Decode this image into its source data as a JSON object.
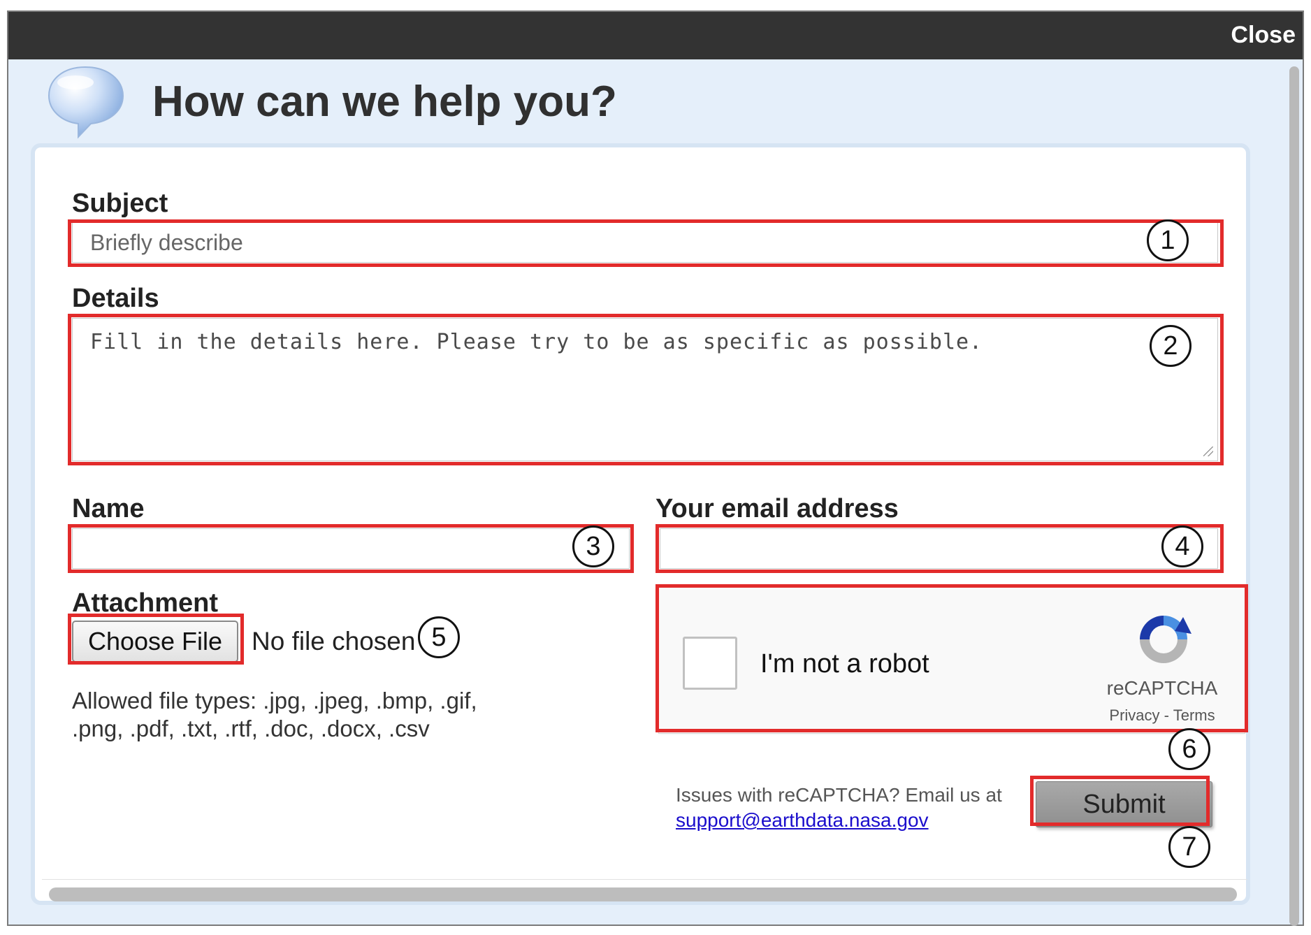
{
  "window": {
    "close_label": "Close"
  },
  "header": {
    "title": "How can we help you?",
    "icon": "speech-bubble-icon"
  },
  "form": {
    "subject": {
      "label": "Subject",
      "placeholder": "Briefly describe",
      "value": ""
    },
    "details": {
      "label": "Details",
      "placeholder": "Fill in the details here. Please try to be as specific as possible.",
      "value": ""
    },
    "name": {
      "label": "Name",
      "value": ""
    },
    "email": {
      "label": "Your email address",
      "value": ""
    },
    "attachment": {
      "label": "Attachment",
      "button_label": "Choose File",
      "status": "No file chosen",
      "allowed_line1": "Allowed file types: .jpg, .jpeg, .bmp, .gif,",
      "allowed_line2": ".png, .pdf, .txt, .rtf, .doc, .docx, .csv"
    },
    "recaptcha": {
      "checkbox_label": "I'm not a robot",
      "brand": "reCAPTCHA",
      "privacy": "Privacy",
      "separator": "-",
      "terms": "Terms",
      "checked": false
    },
    "issues_text": "Issues with reCAPTCHA? Email us at",
    "support_email": "support@earthdata.nasa.gov",
    "submit_label": "Submit"
  },
  "annotations": [
    "1",
    "2",
    "3",
    "4",
    "5",
    "6",
    "7"
  ],
  "colors": {
    "annotation_border": "#e22b2b",
    "titlebar": "#333333",
    "dialog_background": "#e5effa",
    "link": "#1a0dcc"
  }
}
